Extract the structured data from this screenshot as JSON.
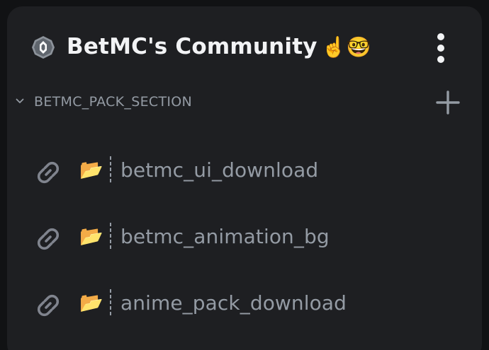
{
  "server": {
    "name": "BetMC's Community",
    "emoji": "☝️🤓",
    "badge_icon": "server-boost-badge-icon",
    "menu_icon": "vertical-ellipsis-icon"
  },
  "section": {
    "label": "BETMC_PACK_SECTION",
    "collapse_icon": "chevron-down-icon",
    "add_icon": "plus-icon"
  },
  "channels": [
    {
      "icon": "link-icon",
      "emoji": "📂",
      "name": "betmc_ui_download"
    },
    {
      "icon": "link-icon",
      "emoji": "📂",
      "name": "betmc_animation_bg"
    },
    {
      "icon": "link-icon",
      "emoji": "📂",
      "name": "anime_pack_download"
    }
  ],
  "colors": {
    "background": "#111214",
    "panel": "#1e1f22",
    "title": "#f2f3f5",
    "muted": "#949ba4"
  }
}
